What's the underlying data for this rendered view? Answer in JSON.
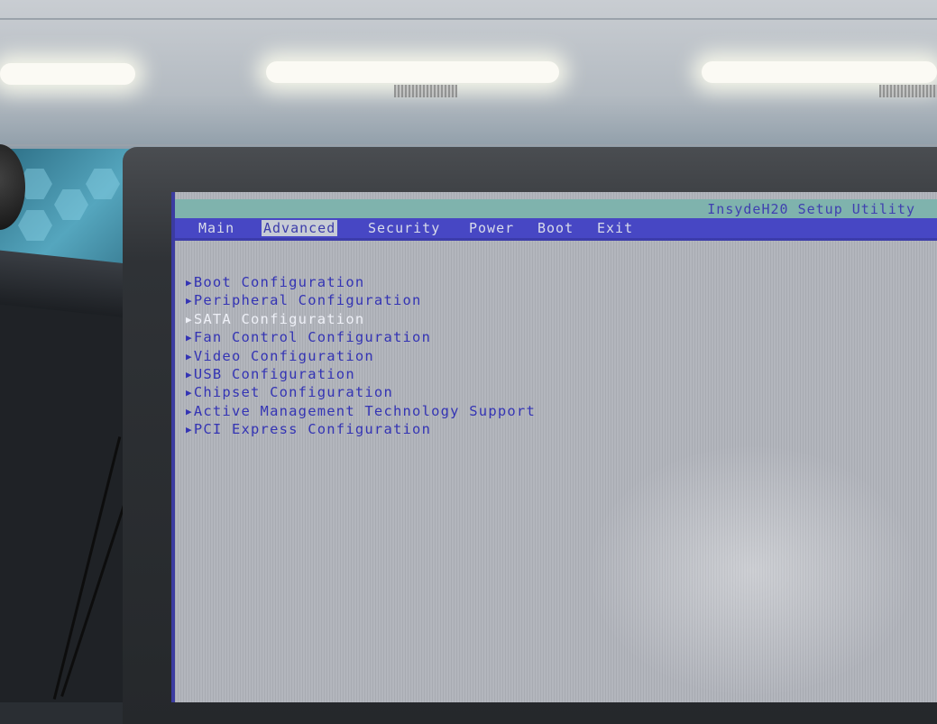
{
  "window": {
    "title": "InsydeH20 Setup Utility"
  },
  "menu": {
    "tabs": [
      {
        "label": "Main"
      },
      {
        "label": "Advanced"
      },
      {
        "label": "Security"
      },
      {
        "label": "Power"
      },
      {
        "label": "Boot"
      },
      {
        "label": "Exit"
      }
    ],
    "active_tab": "Advanced"
  },
  "advanced": {
    "items": [
      {
        "label": "Boot Configuration"
      },
      {
        "label": "Peripheral Configuration"
      },
      {
        "label": "SATA Configuration"
      },
      {
        "label": "Fan Control Configuration"
      },
      {
        "label": "Video Configuration"
      },
      {
        "label": "USB Configuration"
      },
      {
        "label": "Chipset Configuration"
      },
      {
        "label": "Active Management Technology Support"
      },
      {
        "label": "PCI Express Configuration"
      }
    ],
    "selected_item": "SATA Configuration",
    "submenu_marker": "▶"
  },
  "colors": {
    "utility_bar": "#7fb3ad",
    "menu_bar": "#4747c4",
    "text_blue": "#3434b4",
    "highlight_text": "#eef0f7",
    "screen_bg": "#b3b6bd"
  }
}
